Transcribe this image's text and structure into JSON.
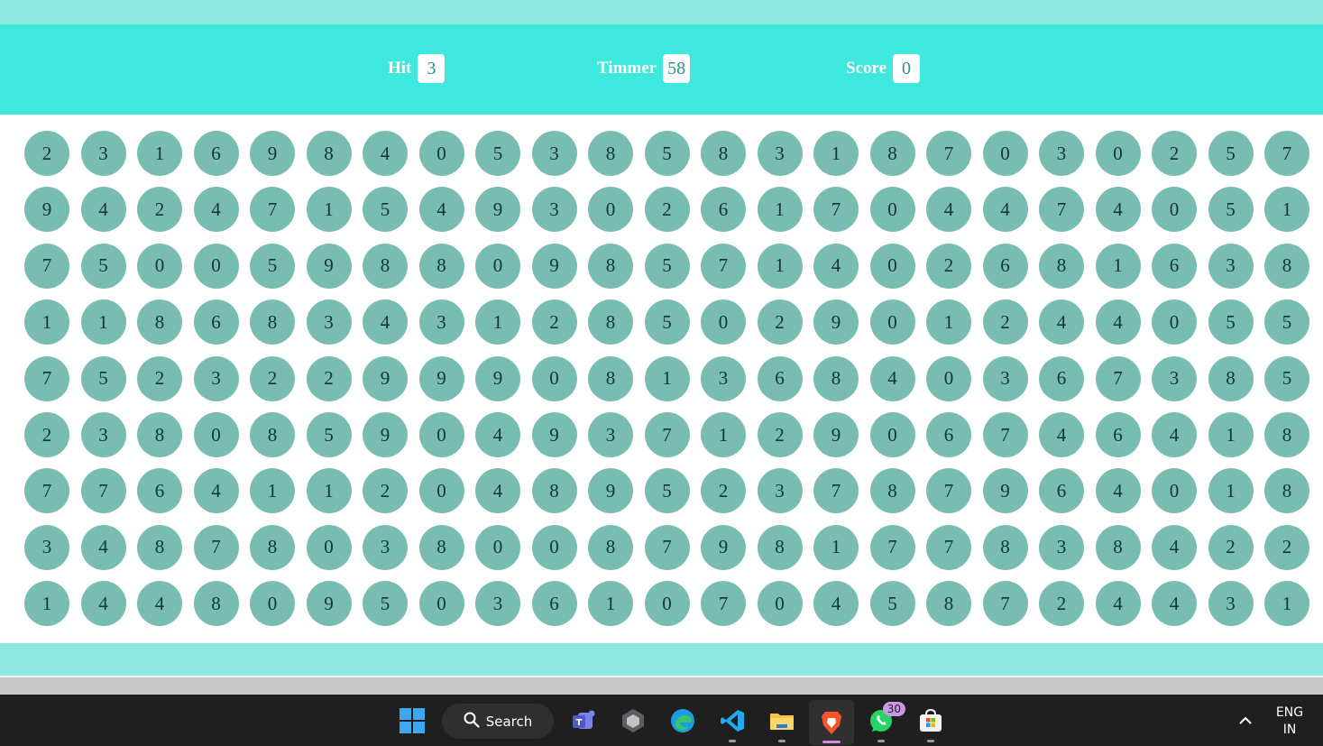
{
  "header": {
    "hit": {
      "label": "Hit",
      "value": "3"
    },
    "timer": {
      "label": "Timmer",
      "value": "58"
    },
    "score": {
      "label": "Score",
      "value": "0"
    }
  },
  "board": {
    "rows": [
      [
        "2",
        "3",
        "1",
        "6",
        "9",
        "8",
        "4",
        "0",
        "5",
        "3",
        "8",
        "5",
        "8",
        "3",
        "1",
        "8",
        "7",
        "0",
        "3",
        "0",
        "2",
        "5",
        "7"
      ],
      [
        "9",
        "4",
        "2",
        "4",
        "7",
        "1",
        "5",
        "4",
        "9",
        "3",
        "0",
        "2",
        "6",
        "1",
        "7",
        "0",
        "4",
        "4",
        "7",
        "4",
        "0",
        "5",
        "1"
      ],
      [
        "7",
        "5",
        "0",
        "0",
        "5",
        "9",
        "8",
        "8",
        "0",
        "9",
        "8",
        "5",
        "7",
        "1",
        "4",
        "0",
        "2",
        "6",
        "8",
        "1",
        "6",
        "3",
        "8"
      ],
      [
        "1",
        "1",
        "8",
        "6",
        "8",
        "3",
        "4",
        "3",
        "1",
        "2",
        "8",
        "5",
        "0",
        "2",
        "9",
        "0",
        "1",
        "2",
        "4",
        "4",
        "0",
        "5",
        "5"
      ],
      [
        "7",
        "5",
        "2",
        "3",
        "2",
        "2",
        "9",
        "9",
        "9",
        "0",
        "8",
        "1",
        "3",
        "6",
        "8",
        "4",
        "0",
        "3",
        "6",
        "7",
        "3",
        "8",
        "5"
      ],
      [
        "2",
        "3",
        "8",
        "0",
        "8",
        "5",
        "9",
        "0",
        "4",
        "9",
        "3",
        "7",
        "1",
        "2",
        "9",
        "0",
        "6",
        "7",
        "4",
        "6",
        "4",
        "1",
        "8"
      ],
      [
        "7",
        "7",
        "6",
        "4",
        "1",
        "1",
        "2",
        "0",
        "4",
        "8",
        "9",
        "5",
        "2",
        "3",
        "7",
        "8",
        "7",
        "9",
        "6",
        "4",
        "0",
        "1",
        "8"
      ],
      [
        "3",
        "4",
        "8",
        "7",
        "8",
        "0",
        "3",
        "8",
        "0",
        "0",
        "8",
        "7",
        "9",
        "8",
        "1",
        "7",
        "7",
        "8",
        "3",
        "8",
        "4",
        "2",
        "2"
      ],
      [
        "1",
        "4",
        "4",
        "8",
        "0",
        "9",
        "5",
        "0",
        "3",
        "6",
        "1",
        "0",
        "7",
        "0",
        "4",
        "5",
        "8",
        "7",
        "2",
        "4",
        "4",
        "3",
        "1"
      ]
    ]
  },
  "colors": {
    "header_bg": "#3ee8dc",
    "band_bg": "#8fe9e0",
    "bubble_bg": "#79bdb2",
    "taskbar_bg": "#1f1f1f"
  },
  "taskbar": {
    "search_label": "Search",
    "whatsapp_badge": "30",
    "language": "ENG",
    "region": "IN",
    "icons": [
      "windows-start-icon",
      "search-icon",
      "teams-icon",
      "app-icon",
      "edge-icon",
      "vscode-icon",
      "file-explorer-icon",
      "brave-icon",
      "whatsapp-icon",
      "store-icon",
      "chevron-up-icon"
    ]
  }
}
